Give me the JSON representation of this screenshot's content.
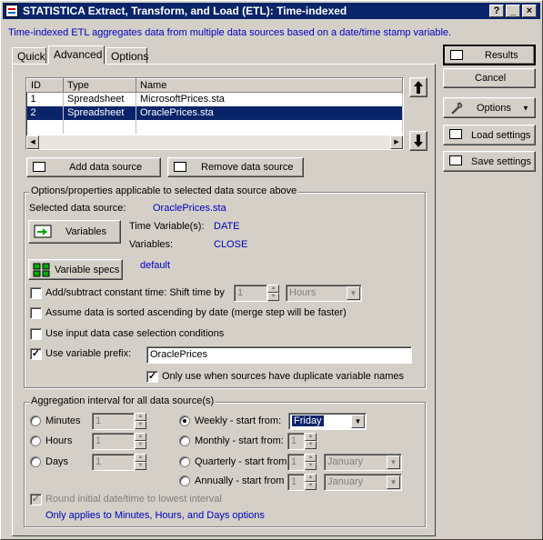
{
  "window": {
    "title": "STATISTICA Extract, Transform, and Load (ETL): Time-indexed",
    "controls": {
      "help": "?",
      "minimize": "_",
      "close": "×"
    }
  },
  "description": "Time-indexed ETL aggregates data from multiple data sources based on a date/time stamp variable.",
  "tabs": [
    "Quick",
    "Advanced",
    "Options"
  ],
  "active_tab": "Advanced",
  "sources_table": {
    "columns": [
      "ID",
      "Type",
      "Name"
    ],
    "rows": [
      {
        "id": "1",
        "type": "Spreadsheet",
        "name": "MicrosoftPrices.sta"
      },
      {
        "id": "2",
        "type": "Spreadsheet",
        "name": "OraclePrices.sta"
      }
    ],
    "selected_row": 1
  },
  "buttons": {
    "add_source": "Add data source",
    "remove_source": "Remove data source",
    "variables": "Variables",
    "variable_specs": "Variable specs"
  },
  "props": {
    "group_label": "Options/properties applicable to selected data source above",
    "selected_label": "Selected data source:",
    "selected_value": "OraclePrices.sta",
    "time_var_label": "Time Variable(s):",
    "time_var_value": "DATE",
    "variables_label": "Variables:",
    "variables_value": "CLOSE",
    "specs_value": "default",
    "shift_label": "Add/subtract constant time: Shift time by",
    "shift_value": "1",
    "shift_unit": "Hours",
    "sorted_label": "Assume data is sorted ascending by date (merge step will be faster)",
    "case_sel_label": "Use input data case selection conditions",
    "prefix_label": "Use variable prefix:",
    "prefix_value": "OraclePrices",
    "only_dup_label": "Only use when sources have duplicate variable names",
    "checks": {
      "shift": false,
      "sorted": false,
      "case_sel": false,
      "prefix": true,
      "only_dup": true
    }
  },
  "aggregation": {
    "group_label": "Aggregation interval for all data source(s)",
    "minutes": {
      "label": "Minutes",
      "value": "1"
    },
    "hours": {
      "label": "Hours",
      "value": "1"
    },
    "days": {
      "label": "Days",
      "value": "1"
    },
    "weekly": {
      "label": "Weekly - start from:",
      "value": "Friday"
    },
    "monthly": {
      "label": "Monthly - start from:",
      "value": "1"
    },
    "quarterly": {
      "label": "Quarterly - start from",
      "value": "1",
      "month": "January"
    },
    "annually": {
      "label": "Annually - start from",
      "value": "1",
      "month": "January"
    },
    "selected": "Weekly",
    "round_label": "Round initial date/time to lowest interval",
    "round_checked": true,
    "note": "Only applies to Minutes, Hours, and Days options"
  },
  "side_buttons": {
    "results": "Results",
    "cancel": "Cancel",
    "options": "Options",
    "load": "Load settings",
    "save": "Save settings"
  },
  "icons": [
    "up-arrow-icon",
    "down-arrow-icon",
    "grid-icon",
    "variables-icon",
    "variable-specs-icon",
    "wrench-icon",
    "dropdown-arrow-icon"
  ]
}
